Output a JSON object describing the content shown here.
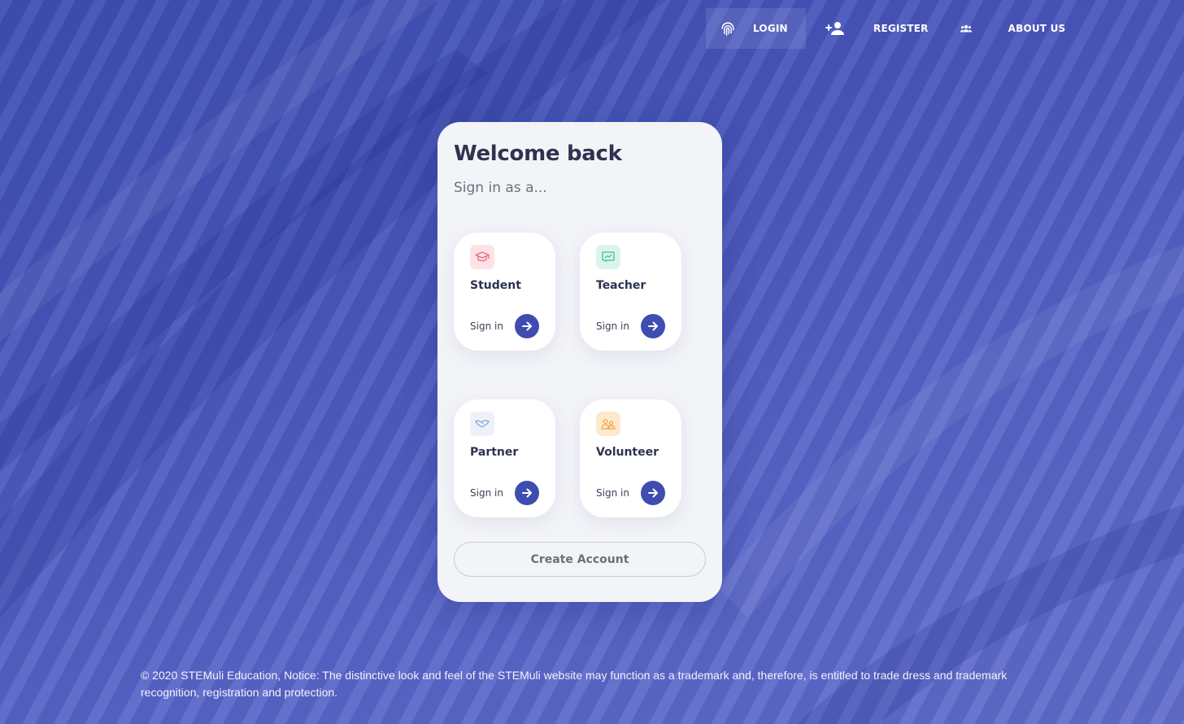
{
  "nav": {
    "login_label": "LOGIN",
    "register_label": "REGISTER",
    "about_label": "ABOUT US"
  },
  "card": {
    "title": "Welcome back",
    "subtitle": "Sign in as a...",
    "roles": [
      {
        "name": "Student",
        "signin": "Sign in",
        "icon": "graduation-cap-icon",
        "icon_bg": "#fde2e6",
        "icon_color": "#e86a7f"
      },
      {
        "name": "Teacher",
        "signin": "Sign in",
        "icon": "chalkboard-icon",
        "icon_bg": "#dcf5ec",
        "icon_color": "#3cbf8e"
      },
      {
        "name": "Partner",
        "signin": "Sign in",
        "icon": "handshake-icon",
        "icon_bg": "#eef1f9",
        "icon_color": "#7fa3d9"
      },
      {
        "name": "Volunteer",
        "signin": "Sign in",
        "icon": "people-icon",
        "icon_bg": "#fde9cf",
        "icon_color": "#f0a33a"
      }
    ],
    "create_account_label": "Create Account"
  },
  "footer": {
    "text": "© 2020 STEMuli Education, Notice: The distinctive look and feel of the STEMuli website may function as a trademark and, therefore, is entitled to trade dress and trademark recognition, registration and protection."
  },
  "colors": {
    "accent": "#3f4db0",
    "background": "#5562c2",
    "card": "#f3f4f8"
  }
}
